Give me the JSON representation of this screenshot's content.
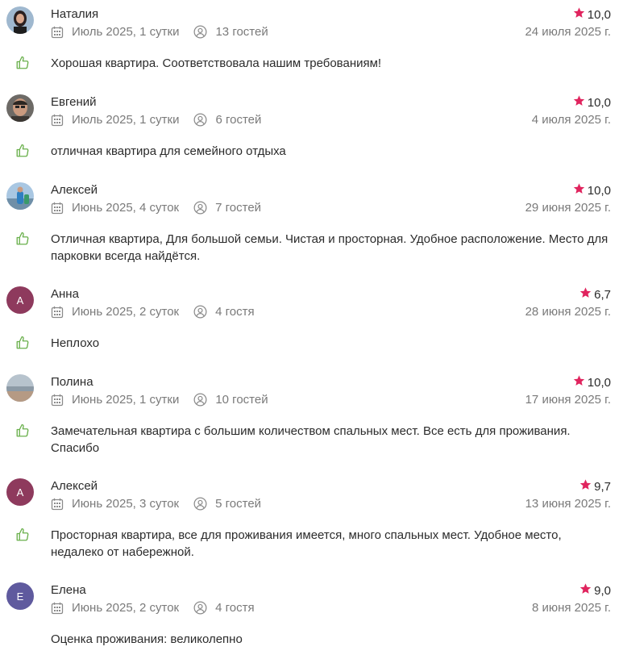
{
  "colors": {
    "star": "#e0245e",
    "like": "#6ab04c",
    "avatar_purple": "#8e3a5d",
    "avatar_violet": "#5f5a9e"
  },
  "reviews": [
    {
      "name": "Наталия",
      "rating": "10,0",
      "period": "Июль 2025, 1 сутки",
      "guests": "13 гостей",
      "date": "24 июля 2025 г.",
      "text": "Хорошая квартира. Соответствовала нашим требованиям!",
      "avatar": "photo"
    },
    {
      "name": "Евгений",
      "rating": "10,0",
      "period": "Июль 2025, 1 сутки",
      "guests": "6 гостей",
      "date": "4 июля 2025 г.",
      "text": "отличная квартира для семейного отдыха",
      "avatar": "photo"
    },
    {
      "name": "Алексей",
      "rating": "10,0",
      "period": "Июнь 2025, 4 суток",
      "guests": "7 гостей",
      "date": "29 июня 2025 г.",
      "text": "Отличная квартира, Для большой семьи. Чистая и просторная. Удобное расположение. Место для парковки всегда найдётся.",
      "avatar": "photo"
    },
    {
      "name": "Анна",
      "rating": "6,7",
      "period": "Июнь 2025, 2 суток",
      "guests": "4 гостя",
      "date": "28 июня 2025 г.",
      "text": "Неплохо",
      "avatar_letter": "А"
    },
    {
      "name": "Полина",
      "rating": "10,0",
      "period": "Июнь 2025, 1 сутки",
      "guests": "10 гостей",
      "date": "17 июня 2025 г.",
      "text": "Замечательная квартира с большим количеством спальных мест. Все есть для проживания. Спасибо",
      "avatar": "photo"
    },
    {
      "name": "Алексей",
      "rating": "9,7",
      "period": "Июнь 2025, 3 суток",
      "guests": "5 гостей",
      "date": "13 июня 2025 г.",
      "text": "Просторная квартира, все для проживания имеется, много спальных мест. Удобное место, недалеко от набережной.",
      "avatar_letter": "А"
    },
    {
      "name": "Елена",
      "rating": "9,0",
      "period": "Июнь 2025, 2 суток",
      "guests": "4 гостя",
      "date": "8 июня 2025 г.",
      "text": "Оценка проживания: великолепно",
      "avatar_letter": "Е"
    }
  ]
}
